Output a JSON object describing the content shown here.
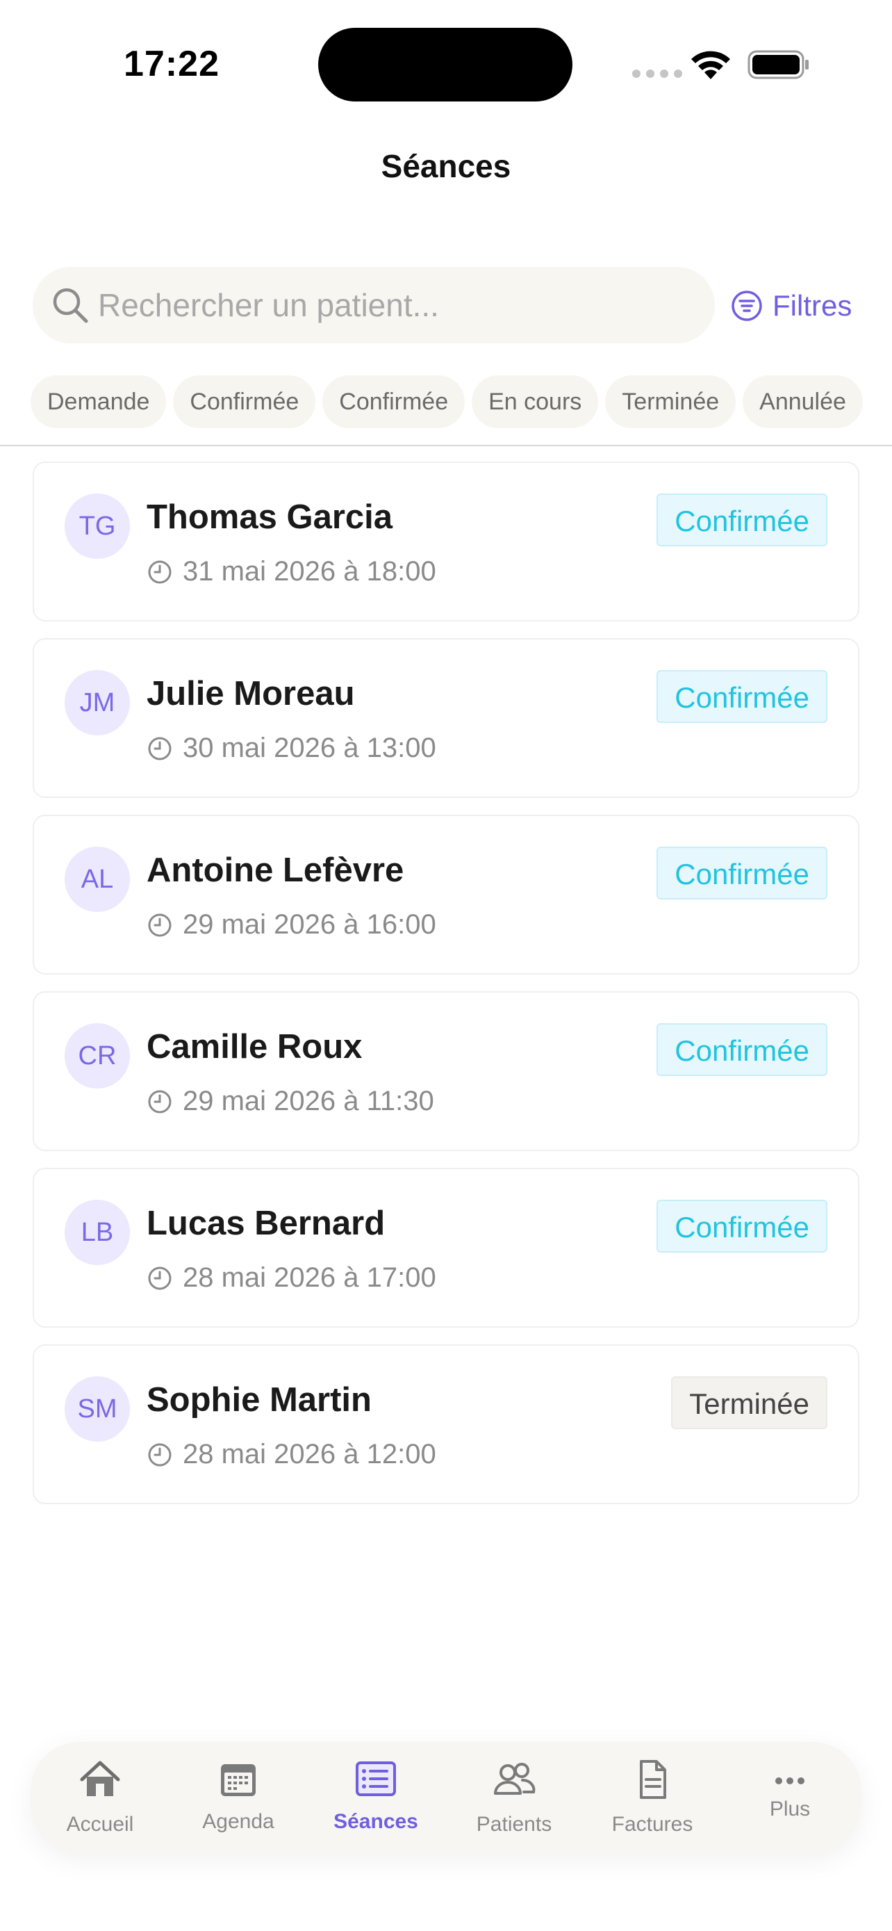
{
  "status_bar": {
    "time": "17:22"
  },
  "header": {
    "title": "Séances"
  },
  "search": {
    "placeholder": "Rechercher un patient..."
  },
  "filters": {
    "label": "Filtres"
  },
  "chips": [
    "Demande",
    "Confirmée",
    "Confirmée",
    "En cours",
    "Terminée",
    "Annulée"
  ],
  "sessions": [
    {
      "initials": "TG",
      "name": "Thomas Garcia",
      "datetime": "31 mai 2026 à 18:00",
      "status": "Confirmée"
    },
    {
      "initials": "JM",
      "name": "Julie Moreau",
      "datetime": "30 mai 2026 à 13:00",
      "status": "Confirmée"
    },
    {
      "initials": "AL",
      "name": "Antoine Lefèvre",
      "datetime": "29 mai 2026 à 16:00",
      "status": "Confirmée"
    },
    {
      "initials": "CR",
      "name": "Camille Roux",
      "datetime": "29 mai 2026 à 11:30",
      "status": "Confirmée"
    },
    {
      "initials": "LB",
      "name": "Lucas Bernard",
      "datetime": "28 mai 2026 à 17:00",
      "status": "Confirmée"
    },
    {
      "initials": "SM",
      "name": "Sophie Martin",
      "datetime": "28 mai 2026 à 12:00",
      "status": "Terminée"
    }
  ],
  "tabs": [
    {
      "label": "Accueil",
      "icon": "home-icon"
    },
    {
      "label": "Agenda",
      "icon": "calendar-icon"
    },
    {
      "label": "Séances",
      "icon": "list-icon",
      "active": true
    },
    {
      "label": "Patients",
      "icon": "users-icon"
    },
    {
      "label": "Factures",
      "icon": "document-icon"
    },
    {
      "label": "Plus",
      "icon": "more-icon"
    }
  ],
  "colors": {
    "accent": "#6f5fe0",
    "confirmed_text": "#22c3e0",
    "confirmed_bg": "#e6f8fd",
    "avatar_bg": "#ece8fd"
  }
}
